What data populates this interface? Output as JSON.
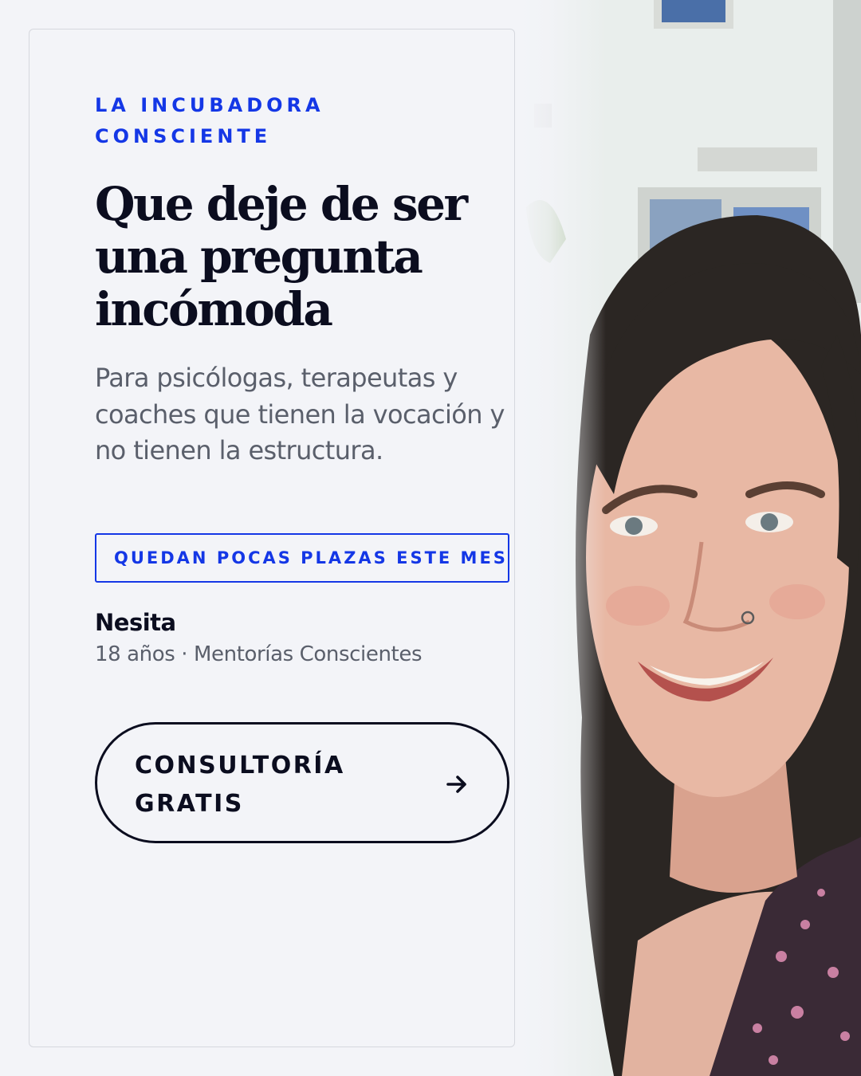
{
  "card": {
    "eyebrow": "LA INCUBADORA CONSCIENTE",
    "headline": "Que deje de ser una pregunta incómoda",
    "subtitle": "Para psicólogas, terapeutas y coaches que tienen la vocación y no tienen la estructura.",
    "badge": "QUEDAN POCAS PLAZAS ESTE MES",
    "author_name": "Nesita",
    "author_meta": "18 años · Mentorías Conscientes",
    "cta_label": "CONSULTORÍA GRATIS",
    "cta_icon": "arrow-right-icon"
  },
  "photo": {
    "subject": "smiling-woman-portrait"
  },
  "colors": {
    "accent": "#1437e6",
    "text_dark": "#0b0d1f",
    "text_muted": "#5a5f6b",
    "background": "#f3f4f8"
  }
}
